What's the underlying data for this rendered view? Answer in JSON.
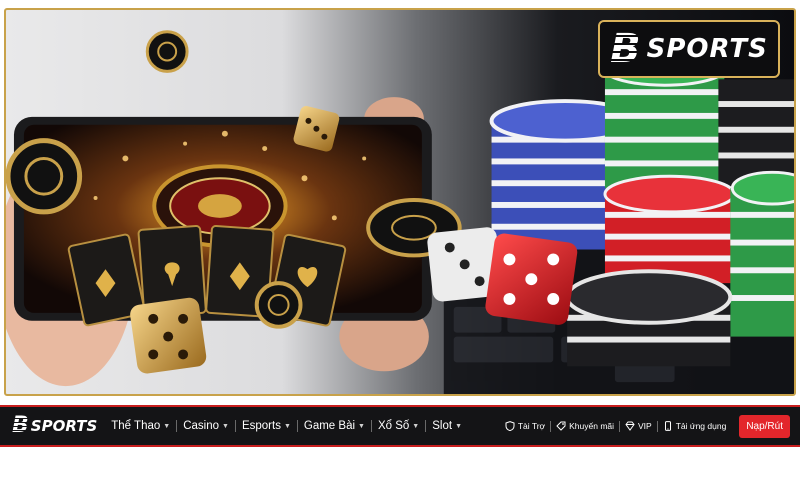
{
  "brand": {
    "mark": "B",
    "word": "SPORTS"
  },
  "nav": {
    "menu": [
      {
        "label": "Thể Thao",
        "name": "menu-the-thao"
      },
      {
        "label": "Casino",
        "name": "menu-casino"
      },
      {
        "label": "Esports",
        "name": "menu-esports"
      },
      {
        "label": "Game Bài",
        "name": "menu-game-bai"
      },
      {
        "label": "Xổ Số",
        "name": "menu-xo-so"
      },
      {
        "label": "Slot",
        "name": "menu-slot"
      }
    ],
    "links": {
      "sponsor": "Tài Trợ",
      "promo": "Khuyến mãi",
      "vip": "VIP",
      "app": "Tải ứng dụng"
    },
    "cta": "Nạp/Rút"
  },
  "colors": {
    "accent_red": "#e3262b",
    "gold_border": "#c8a24a",
    "nav_bg": "#141416"
  },
  "icons": {
    "sponsor": "shield-icon",
    "promo": "tag-icon",
    "vip": "diamond-icon",
    "app": "phone-icon",
    "menu_caret": "caret-down-icon"
  }
}
